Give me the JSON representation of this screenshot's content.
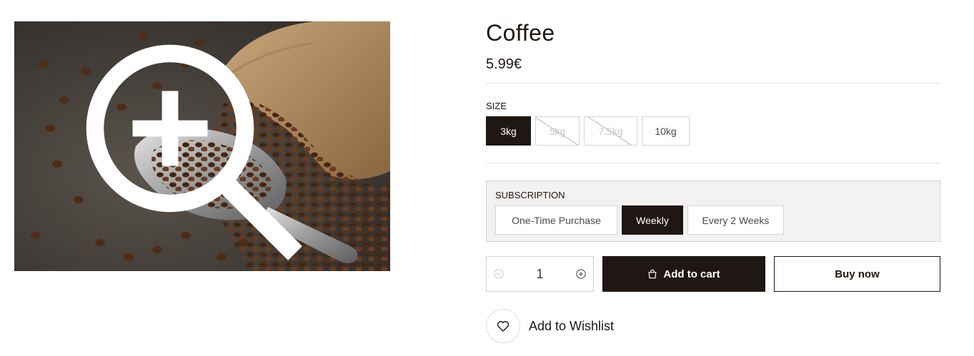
{
  "product": {
    "title": "Coffee",
    "price": "5.99€",
    "image_alt": "Coffee beans with metal scoop and burlap sack"
  },
  "size": {
    "label": "SIZE",
    "options": [
      {
        "label": "3kg",
        "state": "selected"
      },
      {
        "label": "5kg",
        "state": "unavailable"
      },
      {
        "label": "7.5kg",
        "state": "unavailable"
      },
      {
        "label": "10kg",
        "state": "available"
      }
    ]
  },
  "subscription": {
    "label": "SUBSCRIPTION",
    "options": [
      {
        "label": "One-Time Purchase",
        "state": "available"
      },
      {
        "label": "Weekly",
        "state": "selected"
      },
      {
        "label": "Every 2 Weeks",
        "state": "available"
      }
    ]
  },
  "cart": {
    "quantity": "1",
    "add_to_cart_label": "Add to cart",
    "buy_now_label": "Buy now"
  },
  "wishlist": {
    "label": "Add to Wishlist"
  },
  "icons": {
    "zoom": "zoom-in-icon",
    "minus": "minus-circle-icon",
    "plus": "plus-circle-icon",
    "bag": "shopping-bag-icon",
    "heart": "heart-icon"
  },
  "colors": {
    "primary": "#1f1713",
    "border": "#d4d4d4",
    "subscription_bg": "#f2f2f2"
  }
}
